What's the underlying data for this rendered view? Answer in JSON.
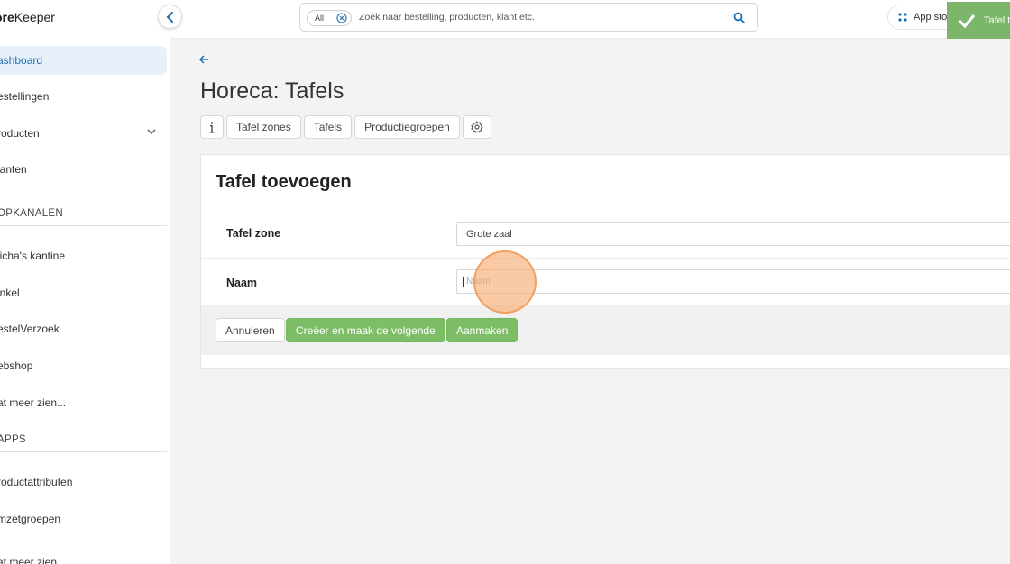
{
  "app": {
    "logo_bold": "ore",
    "logo_rest": "Keeper"
  },
  "sidebar": {
    "items": [
      {
        "label": "ashboard",
        "active": true
      },
      {
        "label": "estellingen"
      },
      {
        "label": "roducten",
        "has_chevron": true
      },
      {
        "label": "lanten"
      }
    ],
    "section1": "OPKANALEN",
    "channels": [
      {
        "label": "licha's kantine"
      },
      {
        "label": "inkel"
      },
      {
        "label": "estelVerzoek"
      },
      {
        "label": "ebshop"
      },
      {
        "label": "at meer zien..."
      }
    ],
    "section2": "APPS",
    "apps": [
      {
        "label": "roductattributen"
      },
      {
        "label": "mzetgroepen"
      },
      {
        "label": "at meer zien..."
      }
    ]
  },
  "search": {
    "chip": "All",
    "placeholder": "Zoek naar bestelling, producten, klant etc."
  },
  "topbar": {
    "appstore_label": "App store"
  },
  "toast": {
    "text": "Tafel t"
  },
  "page": {
    "title": "Horeca: Tafels",
    "tabs": [
      "Tafel zones",
      "Tafels",
      "Productiegroepen"
    ]
  },
  "form": {
    "title": "Tafel toevoegen",
    "zone_label": "Tafel zone",
    "zone_value": "Grote zaal",
    "name_label": "Naam",
    "name_placeholder": "Naam",
    "cancel": "Annuleren",
    "create_next": "Creëer en maak de volgende",
    "create": "Aanmaken"
  },
  "colors": {
    "accent": "#1a6fb5",
    "success": "#7cbd65"
  }
}
